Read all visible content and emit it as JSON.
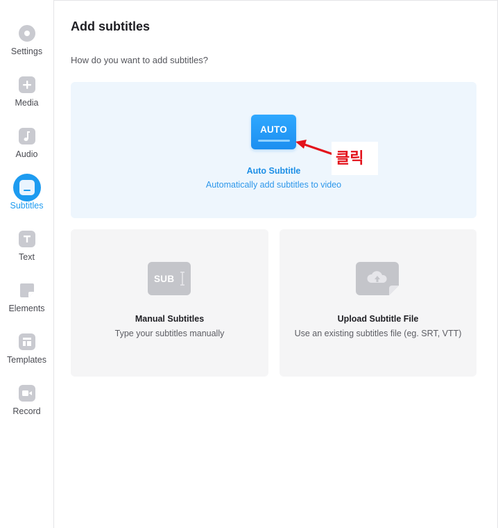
{
  "sidebar": {
    "items": [
      {
        "label": "Settings",
        "icon": "settings-icon"
      },
      {
        "label": "Media",
        "icon": "plus-icon"
      },
      {
        "label": "Audio",
        "icon": "music-note-icon"
      },
      {
        "label": "Subtitles",
        "icon": "subtitles-icon",
        "active": true
      },
      {
        "label": "Text",
        "icon": "text-icon"
      },
      {
        "label": "Elements",
        "icon": "elements-icon"
      },
      {
        "label": "Templates",
        "icon": "templates-icon"
      },
      {
        "label": "Record",
        "icon": "camera-icon"
      }
    ]
  },
  "main": {
    "title": "Add subtitles",
    "question": "How do you want to add subtitles?",
    "options": {
      "auto": {
        "tile_text": "AUTO",
        "title": "Auto Subtitle",
        "description": "Automatically add subtitles to video"
      },
      "manual": {
        "tile_text": "SUB",
        "title": "Manual Subtitles",
        "description": "Type your subtitles manually"
      },
      "upload": {
        "title": "Upload Subtitle File",
        "description": "Use an existing subtitles file (eg. SRT, VTT)"
      }
    }
  },
  "annotation": {
    "text": "클릭",
    "color": "#e3121b"
  },
  "colors": {
    "accent": "#1d9bf0",
    "auto_card_bg": "#eef6fd",
    "card_bg": "#f5f5f6",
    "icon_gray": "#c9cad0"
  }
}
